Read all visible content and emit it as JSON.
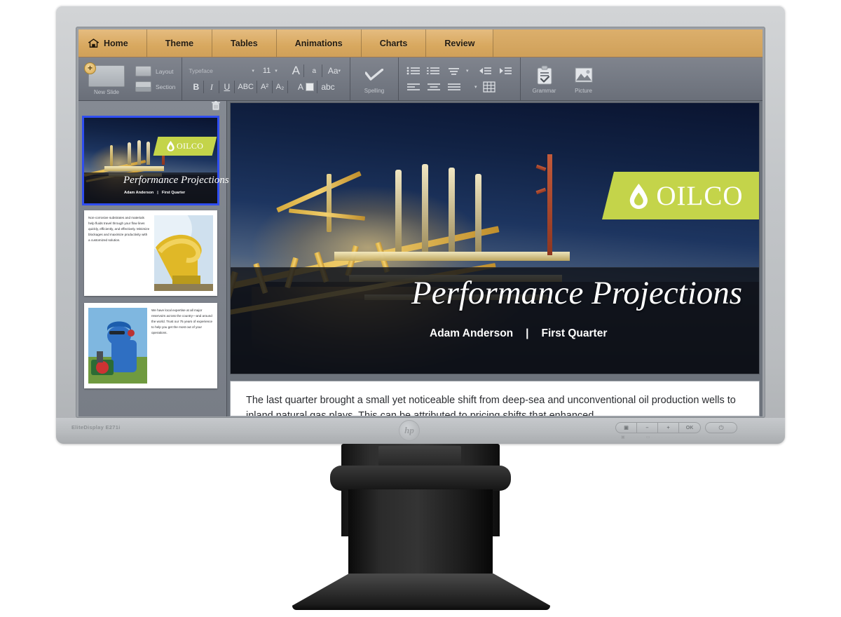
{
  "monitor": {
    "model_label": "EliteDisplay E271i",
    "brand_logo": "hp",
    "osd_buttons": [
      {
        "name": "menu",
        "glyph": "▣"
      },
      {
        "name": "minus",
        "glyph": "–"
      },
      {
        "name": "plus",
        "glyph": "+"
      },
      {
        "name": "ok",
        "glyph": "OK"
      }
    ],
    "osd_sub_icons": [
      "▣",
      "▭"
    ],
    "power_glyph": "⏻"
  },
  "app": {
    "tabs": [
      {
        "label": "Home",
        "icon": "home-icon",
        "active": true
      },
      {
        "label": "Theme",
        "icon": null,
        "active": false
      },
      {
        "label": "Tables",
        "icon": null,
        "active": false
      },
      {
        "label": "Animations",
        "icon": null,
        "active": false
      },
      {
        "label": "Charts",
        "icon": null,
        "active": false
      },
      {
        "label": "Review",
        "icon": null,
        "active": false
      }
    ],
    "ribbon": {
      "new_slide_label": "New Slide",
      "layout_label": "Layout",
      "section_label": "Section",
      "typeface_label": "Typeface",
      "font_size": "11",
      "caret": "▾",
      "format_buttons": [
        {
          "name": "bold",
          "label": "B"
        },
        {
          "name": "italic",
          "label": "I"
        },
        {
          "name": "underline",
          "label": "U"
        },
        {
          "name": "strikethrough",
          "label": "ABC"
        },
        {
          "name": "superscript",
          "label": "A²"
        },
        {
          "name": "subscript",
          "label": "A₂"
        }
      ],
      "size_buttons": [
        {
          "name": "grow-font",
          "label": "A"
        },
        {
          "name": "shrink-font",
          "label": "a"
        },
        {
          "name": "change-case",
          "label": "Aa"
        }
      ],
      "color_buttons": [
        {
          "name": "font-color",
          "label": "A"
        },
        {
          "name": "highlight",
          "label": "abc"
        }
      ],
      "spelling_label": "Spelling",
      "grammar_label": "Grammar",
      "picture_label": "Picture"
    },
    "slide_panel": {
      "delete_icon": "trash-icon",
      "slides": [
        {
          "index": 1,
          "selected": true,
          "type": "title",
          "title": "Performance Projections",
          "presenter": "Adam Anderson",
          "quarter": "First Quarter",
          "divider": "|",
          "logo_text": "OILCO"
        },
        {
          "index": 2,
          "selected": false,
          "type": "text-left-image-right",
          "body": "Non-corrosive substrates and materials help fluids travel through your flow lines quickly, efficiently, and effectively. Minimize blockages and maximize productivity with a customized solution.",
          "image_alt": "yellow-pipeline-image"
        },
        {
          "index": 3,
          "selected": false,
          "type": "image-left-text-right",
          "body": "We have local expertise at all major reservoirs across the country—and around the world. Trust our 75 years of experience to help you get the most out of your operations.",
          "image_alt": "oilfield-worker-image"
        }
      ]
    },
    "main_slide": {
      "title": "Performance Projections",
      "presenter": "Adam Anderson",
      "divider": "|",
      "quarter": "First Quarter",
      "logo_text": "OILCO",
      "logo_icon": "oil-droplet-icon",
      "background_alt": "offshore-oil-rig-at-night"
    },
    "notes": {
      "text": "The last quarter brought a small yet noticeable shift from deep-sea and unconventional oil production wells to inland natural gas plays. This can be attributed to pricing shifts that enhanced"
    }
  },
  "colors": {
    "tab_bar": "#d4a257",
    "ribbon": "#767b85",
    "logo_green": "#c4d44a",
    "selection_blue": "#2f4ef0",
    "bezel_silver": "#c3c6c9"
  }
}
